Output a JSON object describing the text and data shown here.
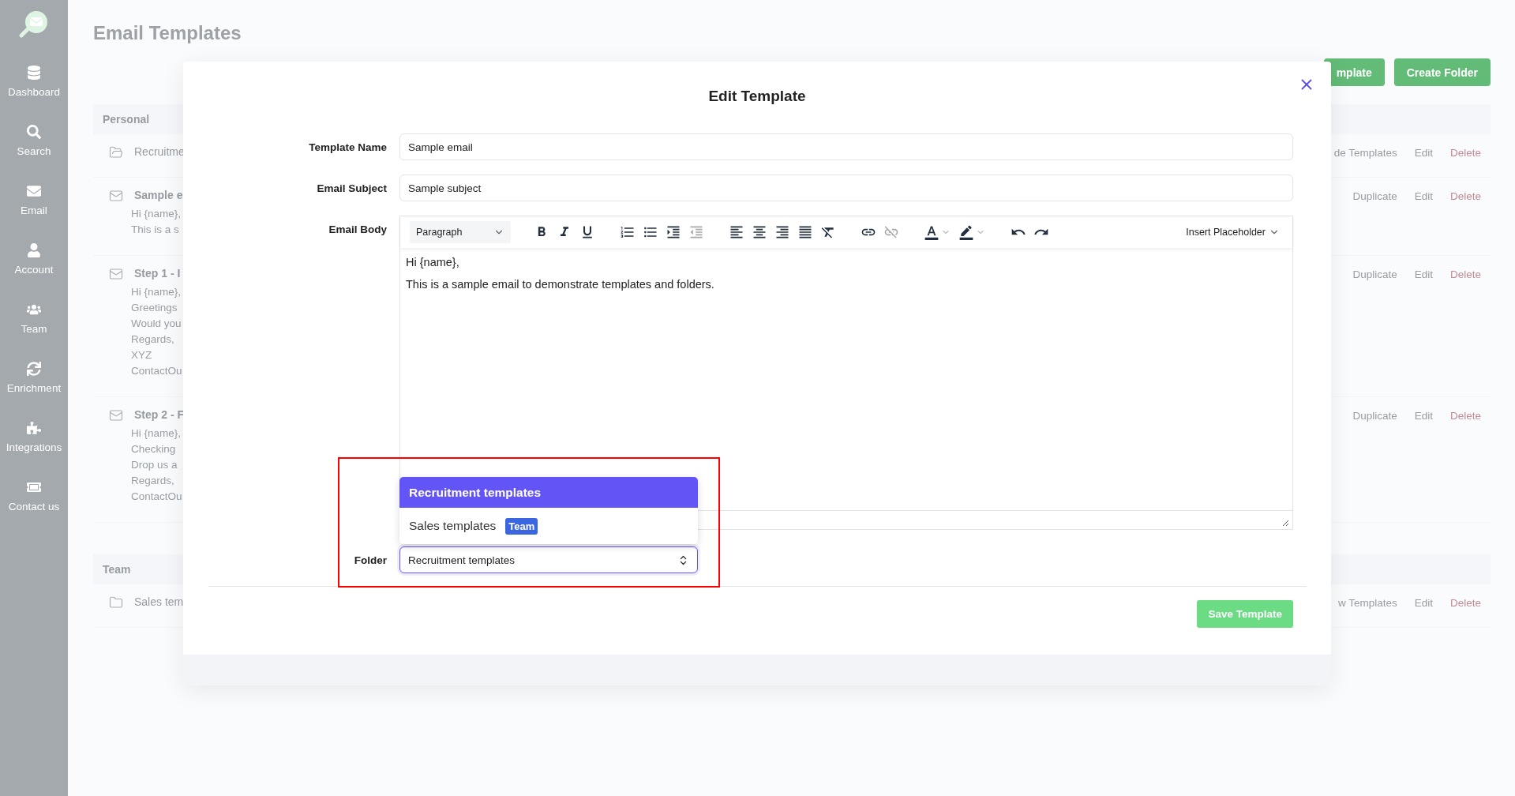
{
  "sidebar": {
    "items": [
      {
        "label": "Dashboard"
      },
      {
        "label": "Search"
      },
      {
        "label": "Email"
      },
      {
        "label": "Account"
      },
      {
        "label": "Team"
      },
      {
        "label": "Enrichment"
      },
      {
        "label": "Integrations"
      },
      {
        "label": "Contact us"
      }
    ]
  },
  "page": {
    "title": "Email Templates",
    "buttons": [
      "mplate",
      "Create Folder"
    ]
  },
  "sections": [
    {
      "title": "Personal",
      "rows": [
        {
          "kind": "folder",
          "name": "Recruitme",
          "actions": [
            {
              "label": "de Templates",
              "kind": "plain"
            },
            {
              "label": "Edit",
              "kind": "plain"
            },
            {
              "label": "Delete",
              "kind": "danger"
            }
          ]
        },
        {
          "kind": "template",
          "name": "Sample e",
          "preview": [
            "Hi {name},",
            "This is a s"
          ],
          "actions": [
            {
              "label": "Duplicate",
              "kind": "plain"
            },
            {
              "label": "Edit",
              "kind": "plain"
            },
            {
              "label": "Delete",
              "kind": "danger"
            }
          ]
        },
        {
          "kind": "template",
          "name": "Step 1 - I",
          "preview": [
            "Hi {name},",
            "Greetings",
            "Would you",
            "Regards,",
            "XYZ",
            "ContactOu"
          ],
          "actions": [
            {
              "label": "Duplicate",
              "kind": "plain"
            },
            {
              "label": "Edit",
              "kind": "plain"
            },
            {
              "label": "Delete",
              "kind": "danger"
            }
          ]
        },
        {
          "kind": "template",
          "name": "Step 2 - F",
          "preview": [
            "Hi {name},",
            "Checking",
            "Drop us a",
            "Regards,",
            "ContactOu"
          ],
          "actions": [
            {
              "label": "Duplicate",
              "kind": "plain"
            },
            {
              "label": "Edit",
              "kind": "plain"
            },
            {
              "label": "Delete",
              "kind": "danger"
            }
          ]
        }
      ]
    },
    {
      "title": "Team",
      "rows": [
        {
          "kind": "folder",
          "name": "Sales tem",
          "actions": [
            {
              "label": "w Templates",
              "kind": "plain"
            },
            {
              "label": "Edit",
              "kind": "plain"
            },
            {
              "label": "Delete",
              "kind": "danger"
            }
          ]
        }
      ]
    }
  ],
  "modal": {
    "title": "Edit Template",
    "fields": [
      {
        "label": "Template Name",
        "value": "Sample email"
      },
      {
        "label": "Email Subject",
        "value": "Sample subject"
      }
    ],
    "editor": {
      "label": "Email Body",
      "block_format": "Paragraph",
      "insert_menu": "Insert Placeholder",
      "toolbar": [
        {
          "kind": "bold",
          "disabled": false
        },
        {
          "kind": "italic",
          "disabled": false
        },
        {
          "kind": "underline",
          "disabled": false
        },
        {
          "kind": "ordered-list",
          "disabled": false
        },
        {
          "kind": "bullet-list",
          "disabled": false
        },
        {
          "kind": "indent",
          "disabled": false
        },
        {
          "kind": "outdent",
          "disabled": true
        },
        {
          "kind": "align-left",
          "disabled": false
        },
        {
          "kind": "align-center",
          "disabled": false
        },
        {
          "kind": "align-right",
          "disabled": false
        },
        {
          "kind": "justify",
          "disabled": false
        },
        {
          "kind": "clear-format",
          "disabled": false
        },
        {
          "kind": "link",
          "disabled": false
        },
        {
          "kind": "unlink",
          "disabled": true
        },
        {
          "kind": "text-color",
          "disabled": false
        },
        {
          "kind": "highlight",
          "disabled": false
        },
        {
          "kind": "undo",
          "disabled": false
        },
        {
          "kind": "redo",
          "disabled": false
        }
      ],
      "lines": [
        "Hi {name},",
        "This is a sample email to demonstrate templates and folders."
      ]
    },
    "folder": {
      "label": "Folder",
      "value": "Recruitment templates",
      "options": [
        {
          "label": "Recruitment templates",
          "selected": true
        },
        {
          "label": "Sales templates",
          "badge": "Team",
          "selected": false
        }
      ]
    },
    "save_button": "Save Template"
  }
}
